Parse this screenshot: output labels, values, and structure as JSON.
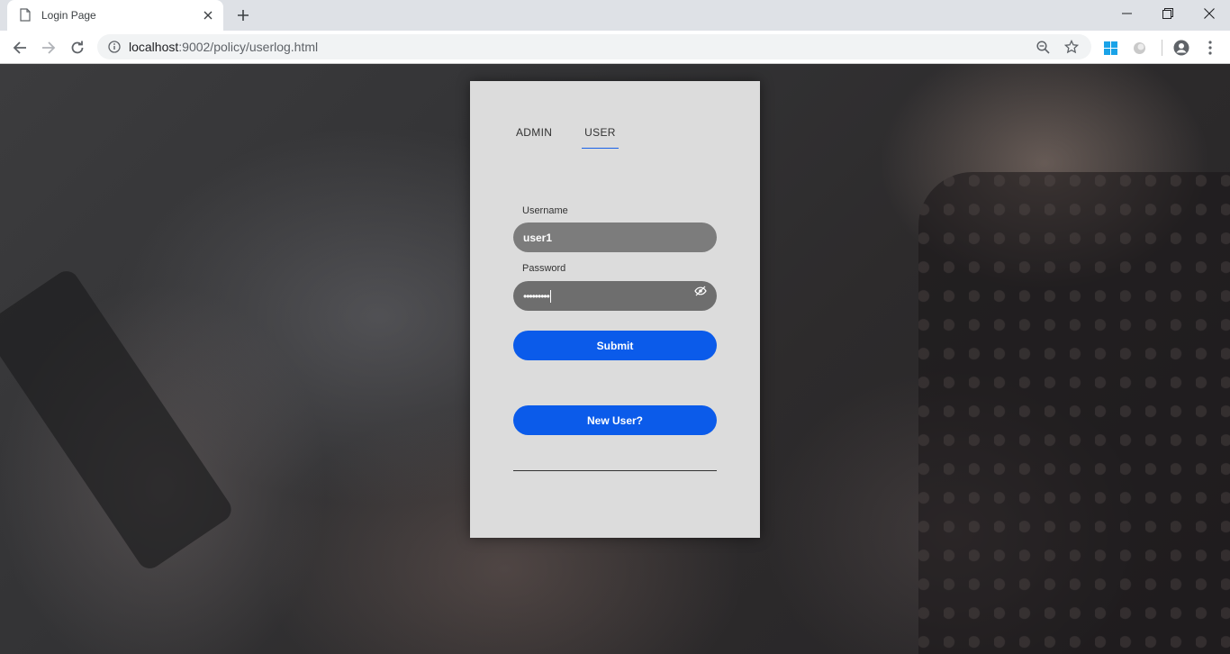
{
  "browser": {
    "tab_title": "Login Page",
    "url_host": "localhost",
    "url_rest": ":9002/policy/userlog.html",
    "icons": {
      "favicon": "page-icon",
      "tab_close": "close-icon",
      "new_tab": "plus-icon",
      "back": "back-arrow-icon",
      "forward": "forward-arrow-icon",
      "reload": "reload-icon",
      "site_info": "info-icon",
      "zoom": "zoom-out-icon",
      "bookmark": "star-icon",
      "extension_windows": "windows-icon",
      "extension_circle": "circle-icon",
      "profile": "account-icon",
      "menu": "kebab-menu-icon",
      "minimize": "minimize-icon",
      "restore": "restore-icon",
      "close_window": "close-window-icon"
    }
  },
  "login": {
    "tabs": [
      {
        "label": "ADMIN",
        "active": false
      },
      {
        "label": "USER",
        "active": true
      }
    ],
    "username_label": "Username",
    "username_value": "user1",
    "password_label": "Password",
    "password_value": "•••••••••",
    "password_icon": "eye-slash-icon",
    "submit_label": "Submit",
    "new_user_label": "New User?"
  },
  "colors": {
    "accent": "#0b5bea",
    "card": "#dcdcdc",
    "input": "#7c7c7c"
  }
}
